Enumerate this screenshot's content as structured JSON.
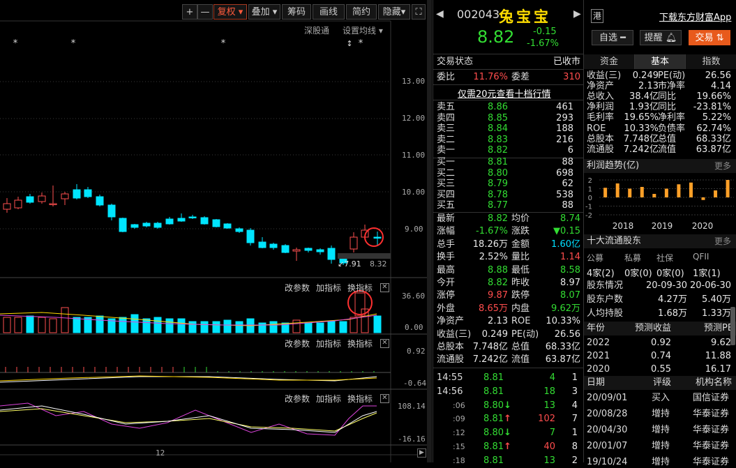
{
  "toolbar": {
    "plus": "+",
    "minus": "—",
    "fuquan": "复权",
    "diejia": "叠加",
    "chouma": "筹码",
    "huaxian": "画线",
    "jianyue": "简约",
    "yincang": "隐藏",
    "fullscreen": "⛶"
  },
  "chart_top": {
    "shengutong": "深股通",
    "shezhi": "设置均线"
  },
  "price_axis": [
    "13.00",
    "12.00",
    "11.00",
    "10.00",
    "9.00"
  ],
  "price_marks": {
    "low_label": "7.91",
    "hline_label": "8.32"
  },
  "vol_panel": {
    "gai": "改参数",
    "jia": "加指标",
    "huan": "换指标",
    "max": "36.60",
    "zero": "0.00"
  },
  "macd_panel": {
    "gai": "改参数",
    "jia": "加指标",
    "huan": "换指标",
    "max": "0.92",
    "min": "-0.64"
  },
  "kdj_panel": {
    "gai": "改参数",
    "jia": "加指标",
    "huan": "换指标",
    "max": "108.14",
    "min": "-16.16"
  },
  "bottom_axis": {
    "label": "12"
  },
  "stock": {
    "code": "002043",
    "name": "兔宝宝",
    "hk": "港",
    "download": "下载东方财富App",
    "price": "8.82",
    "change": "-0.15",
    "pct": "-1.67%"
  },
  "buttons": {
    "zixuan": "自选",
    "tixing": "提醒",
    "jiaoyi": "交易"
  },
  "status": {
    "label": "交易状态",
    "value": "已收市"
  },
  "weibi": {
    "l1": "委比",
    "v1": "11.76%",
    "l2": "委差",
    "v2": "310"
  },
  "promo": "仅需20元查看十档行情",
  "sells": [
    {
      "label": "卖五",
      "price": "8.86",
      "vol": "461"
    },
    {
      "label": "卖四",
      "price": "8.85",
      "vol": "293"
    },
    {
      "label": "卖三",
      "price": "8.84",
      "vol": "188"
    },
    {
      "label": "卖二",
      "price": "8.83",
      "vol": "216"
    },
    {
      "label": "卖一",
      "price": "8.82",
      "vol": "6"
    }
  ],
  "buys": [
    {
      "label": "买一",
      "price": "8.81",
      "vol": "88"
    },
    {
      "label": "买二",
      "price": "8.80",
      "vol": "698"
    },
    {
      "label": "买三",
      "price": "8.79",
      "vol": "62"
    },
    {
      "label": "买四",
      "price": "8.78",
      "vol": "538"
    },
    {
      "label": "买五",
      "price": "8.77",
      "vol": "88"
    }
  ],
  "stats": [
    {
      "l1": "最新",
      "v1": "8.82",
      "c1": "green",
      "l2": "均价",
      "v2": "8.74",
      "c2": "green"
    },
    {
      "l1": "涨幅",
      "v1": "-1.67%",
      "c1": "green",
      "l2": "涨跌",
      "v2": "▼0.15",
      "c2": "green"
    },
    {
      "l1": "总手",
      "v1": "18.26万",
      "c1": "white",
      "l2": "金额",
      "v2": "1.60亿",
      "c2": "cyan"
    },
    {
      "l1": "换手",
      "v1": "2.52%",
      "c1": "white",
      "l2": "量比",
      "v2": "1.14",
      "c2": "red"
    },
    {
      "l1": "最高",
      "v1": "8.88",
      "c1": "green",
      "l2": "最低",
      "v2": "8.58",
      "c2": "green"
    },
    {
      "l1": "今开",
      "v1": "8.82",
      "c1": "green",
      "l2": "昨收",
      "v2": "8.97",
      "c2": "white"
    },
    {
      "l1": "涨停",
      "v1": "9.87",
      "c1": "red",
      "l2": "跌停",
      "v2": "8.07",
      "c2": "green"
    },
    {
      "l1": "外盘",
      "v1": "8.65万",
      "c1": "red",
      "l2": "内盘",
      "v2": "9.62万",
      "c2": "green"
    },
    {
      "l1": "净资产",
      "v1": "2.13",
      "c1": "white",
      "l2": "ROE",
      "v2": "10.33%",
      "c2": "white"
    },
    {
      "l1": "收益(三)",
      "v1": "0.249",
      "c1": "white",
      "l2": "PE(动)",
      "v2": "26.56",
      "c2": "white"
    },
    {
      "l1": "总股本",
      "v1": "7.748亿",
      "c1": "white",
      "l2": "总值",
      "v2": "68.33亿",
      "c2": "white"
    },
    {
      "l1": "流通股",
      "v1": "7.242亿",
      "c1": "white",
      "l2": "流值",
      "v2": "63.87亿",
      "c2": "white"
    }
  ],
  "ticks": [
    {
      "time": "14:55",
      "price": "8.81",
      "arrow": "",
      "vol": "4",
      "n": "1",
      "pc": "green",
      "vc": "green"
    },
    {
      "time": "14:56",
      "price": "8.81",
      "arrow": "",
      "vol": "18",
      "n": "3",
      "pc": "green",
      "vc": "green"
    },
    {
      "time": ":06",
      "price": "8.80",
      "arrow": "↓",
      "vol": "13",
      "n": "4",
      "pc": "green",
      "vc": "green"
    },
    {
      "time": ":09",
      "price": "8.81",
      "arrow": "↑",
      "vol": "102",
      "n": "7",
      "pc": "green",
      "vc": "red"
    },
    {
      "time": ":12",
      "price": "8.80",
      "arrow": "↓",
      "vol": "7",
      "n": "1",
      "pc": "green",
      "vc": "green"
    },
    {
      "time": ":15",
      "price": "8.81",
      "arrow": "↑",
      "vol": "40",
      "n": "8",
      "pc": "green",
      "vc": "red"
    },
    {
      "time": ":18",
      "price": "8.81",
      "arrow": "",
      "vol": "13",
      "n": "2",
      "pc": "green",
      "vc": "green"
    }
  ],
  "f10_tabs": [
    "资金",
    "基本",
    "指数"
  ],
  "fundamentals": [
    {
      "l1": "收益(三)",
      "v1": "0.249",
      "l2": "PE(动)",
      "v2": "26.56"
    },
    {
      "l1": "净资产",
      "v1": "2.13",
      "l2": "市净率",
      "v2": "4.14"
    },
    {
      "l1": "总收入",
      "v1": "38.4亿",
      "l2": "同比",
      "v2": "19.66%"
    },
    {
      "l1": "净利润",
      "v1": "1.93亿",
      "l2": "同比",
      "v2": "-23.81%"
    },
    {
      "l1": "毛利率",
      "v1": "19.65%",
      "l2": "净利率",
      "v2": "5.22%"
    },
    {
      "l1": "ROE",
      "v1": "10.33%",
      "l2": "负债率",
      "v2": "62.74%"
    },
    {
      "l1": "总股本",
      "v1": "7.748亿",
      "l2": "总值",
      "v2": "68.33亿"
    },
    {
      "l1": "流通股",
      "v1": "7.242亿",
      "l2": "流值",
      "v2": "63.87亿"
    }
  ],
  "profit_trend": {
    "title": "利润趋势(亿)",
    "more": "更多",
    "yticks": [
      "2",
      "1",
      "0",
      "-1",
      "-2"
    ],
    "years": [
      "2018",
      "2019",
      "2020"
    ]
  },
  "chart_data": {
    "type": "bar",
    "title": "利润趋势(亿)",
    "xlabel": "",
    "ylabel": "",
    "ylim": [
      -2,
      2
    ],
    "x_tick_labels": [
      "2018",
      "2019",
      "2020"
    ],
    "values": [
      1.1,
      1.6,
      1.0,
      1.2,
      0.4,
      1.0,
      1.5,
      1.7,
      -0.3,
      0.8,
      2.0
    ]
  },
  "holders": {
    "title": "十大流通股东",
    "more": "更多",
    "headers": [
      "公募",
      "私募",
      "社保",
      "QFII"
    ],
    "values": [
      "4家(2)",
      "0家(0)",
      "0家(0)",
      "1家(1)"
    ],
    "rows": [
      {
        "label": "股东情况",
        "a": "20-09-30",
        "b": "20-06-30"
      },
      {
        "label": "股东户数",
        "a": "4.27万",
        "b": "5.40万"
      },
      {
        "label": "人均持股",
        "a": "1.68万",
        "b": "1.33万"
      }
    ]
  },
  "forecast": {
    "headers": [
      "年份",
      "预测收益",
      "预测PE"
    ],
    "rows": [
      {
        "year": "2022",
        "eps": "0.92",
        "pe": "9.62"
      },
      {
        "year": "2021",
        "eps": "0.74",
        "pe": "11.88"
      },
      {
        "year": "2020",
        "eps": "0.55",
        "pe": "16.17"
      }
    ]
  },
  "ratings": {
    "headers": [
      "日期",
      "评级",
      "机构名称"
    ],
    "rows": [
      {
        "date": "20/09/01",
        "rating": "买入",
        "org": "国信证券"
      },
      {
        "date": "20/08/28",
        "rating": "增持",
        "org": "华泰证券"
      },
      {
        "date": "20/04/30",
        "rating": "增持",
        "org": "华泰证券"
      },
      {
        "date": "20/01/07",
        "rating": "增持",
        "org": "华泰证券"
      },
      {
        "date": "19/10/24",
        "rating": "增持",
        "org": "华泰证券"
      }
    ]
  }
}
